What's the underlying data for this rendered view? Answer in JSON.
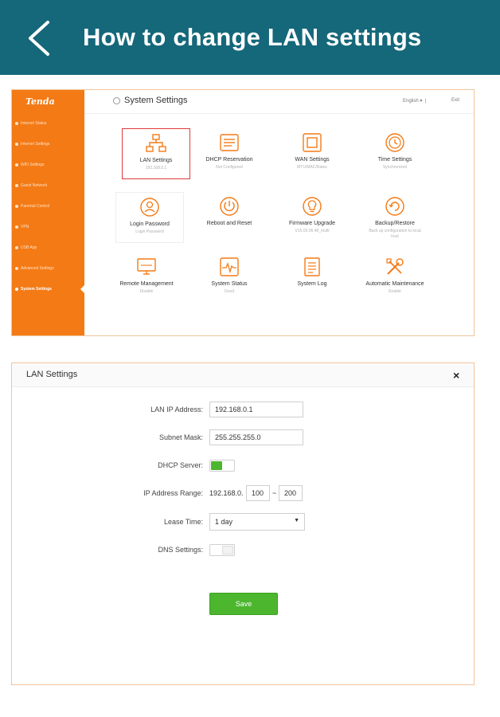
{
  "header": {
    "title": "How to change LAN settings",
    "bg_color": "#15677a"
  },
  "router": {
    "logo": "Tenda",
    "sidebar": [
      "Internet Status",
      "Internet Settings",
      "WiFi Settings",
      "Guest Network",
      "Parental Control",
      "VPN",
      "USB App",
      "Advanced Settings",
      "System Settings"
    ],
    "active_item": "System Settings",
    "page_title": "System Settings",
    "language": "English",
    "exit": "Exit",
    "tiles": [
      {
        "label": "LAN Settings",
        "sub": "192.168.0.1",
        "icon": "lan-icon"
      },
      {
        "label": "DHCP Reservation",
        "sub": "Not Configured",
        "icon": "dhcp-icon"
      },
      {
        "label": "WAN Settings",
        "sub": "MTU/MAC/Rates",
        "icon": "wan-icon"
      },
      {
        "label": "Time Settings",
        "sub": "Synchronized",
        "icon": "clock-icon"
      },
      {
        "label": "Login Password",
        "sub": "Login Password",
        "icon": "user-lock-icon"
      },
      {
        "label": "Reboot and Reset",
        "sub": "",
        "icon": "power-icon"
      },
      {
        "label": "Firmware Upgrade",
        "sub": "V15.03.06.48_multi",
        "icon": "lightbulb-icon"
      },
      {
        "label": "Backup/Restore",
        "sub": "Back up configuration to local host",
        "icon": "backup-icon"
      },
      {
        "label": "Remote Management",
        "sub": "Disable",
        "icon": "monitor-icon"
      },
      {
        "label": "System Status",
        "sub": "Good",
        "icon": "pulse-icon"
      },
      {
        "label": "System Log",
        "sub": "",
        "icon": "log-icon"
      },
      {
        "label": "Automatic Maintenance",
        "sub": "Enable",
        "icon": "tools-icon"
      }
    ],
    "accent_color": "#f47a15"
  },
  "lan": {
    "title": "LAN Settings",
    "close": "×",
    "ip_label": "LAN IP Address:",
    "ip_value": "192.168.0.1",
    "mask_label": "Subnet Mask:",
    "mask_value": "255.255.255.0",
    "dhcp_label": "DHCP Server:",
    "dhcp_on": true,
    "range_label": "IP Address Range:",
    "range_prefix": "192.168.0.",
    "range_start": "100",
    "range_sep": "~",
    "range_end": "200",
    "lease_label": "Lease Time:",
    "lease_value": "1 day",
    "dns_label": "DNS Settings:",
    "dns_on": false,
    "save": "Save",
    "save_color": "#4cb62e"
  }
}
